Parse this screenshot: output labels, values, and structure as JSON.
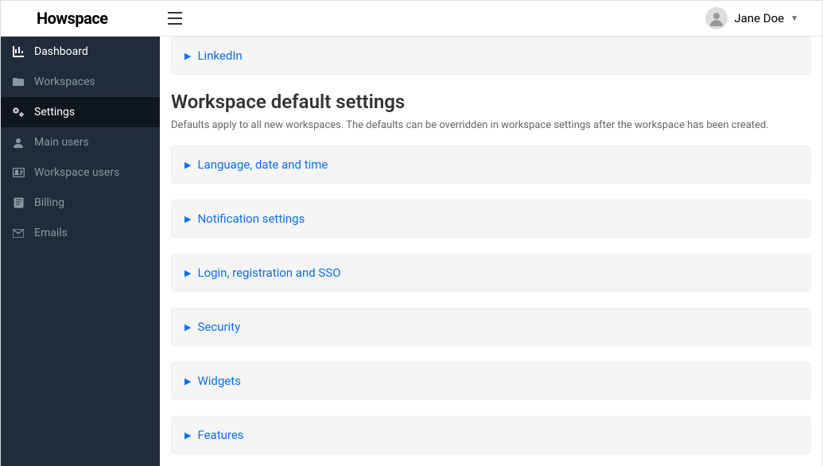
{
  "brand": "Howspace",
  "user": {
    "name": "Jane Doe"
  },
  "sidebar": {
    "items": [
      {
        "label": "Dashboard"
      },
      {
        "label": "Workspaces"
      },
      {
        "label": "Settings"
      },
      {
        "label": "Main users"
      },
      {
        "label": "Workspace users"
      },
      {
        "label": "Billing"
      },
      {
        "label": "Emails"
      }
    ]
  },
  "main": {
    "topPanel": "LinkedIn",
    "sectionTitle": "Workspace default settings",
    "sectionSub": "Defaults apply to all new workspaces. The defaults can be overridden in workspace settings after the workspace has been created.",
    "panels": [
      {
        "label": "Language, date and time"
      },
      {
        "label": "Notification settings"
      },
      {
        "label": "Login, registration and SSO"
      },
      {
        "label": "Security"
      },
      {
        "label": "Widgets"
      },
      {
        "label": "Features"
      }
    ]
  }
}
